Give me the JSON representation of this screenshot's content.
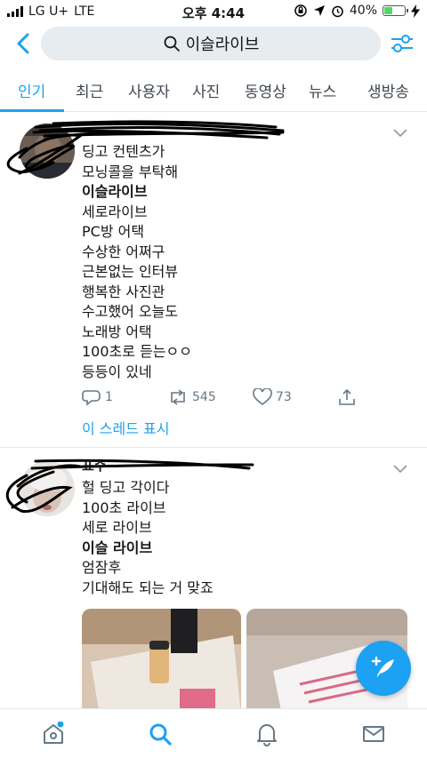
{
  "status_bar": {
    "carrier": "LG U+",
    "network": "LTE",
    "time": "오후 4:44",
    "battery_pct": "40%",
    "battery_level": 0.4
  },
  "search": {
    "query": "이슬라이브",
    "icons": [
      "back-arrow-icon",
      "search-icon",
      "filter-sliders-icon"
    ]
  },
  "tabs": [
    {
      "label": "인기",
      "active": true
    },
    {
      "label": "최근"
    },
    {
      "label": "사용자"
    },
    {
      "label": "사진"
    },
    {
      "label": "동영상"
    },
    {
      "label": "뉴스"
    },
    {
      "label": "생방송"
    }
  ],
  "tweets": [
    {
      "lines": [
        "딩고 컨텐츠가",
        "모닝콜을 부탁해",
        "이슬라이브",
        "세로라이브",
        "PC방 어택",
        "수상한 어쩌구",
        "근본없는 인터뷰",
        "행복한 사진관",
        "수고했어 오늘도",
        "노래방 어택",
        "100초로 듣는ㅇㅇ",
        "등등이 있네"
      ],
      "bold_line": 2,
      "reply_count": "1",
      "retweet_count": "545",
      "like_count": "73",
      "thread_link": "이 스레드 표시"
    },
    {
      "header_partial": "표수",
      "lines": [
        "헐 딩고 각이다",
        "100초 라이브",
        "세로 라이브",
        "이슬 라이브",
        "엄잠후",
        "기대해도 되는 거 맞죠"
      ],
      "bold_line": 3
    }
  ],
  "colors": {
    "accent": "#1da1f2",
    "text": "#14171a",
    "muted": "#657786",
    "divider": "#e1e8ed",
    "battery": "#4cd964"
  },
  "bottom_nav": [
    "home-icon",
    "search-icon",
    "notifications-bell-icon",
    "messages-mail-icon"
  ]
}
